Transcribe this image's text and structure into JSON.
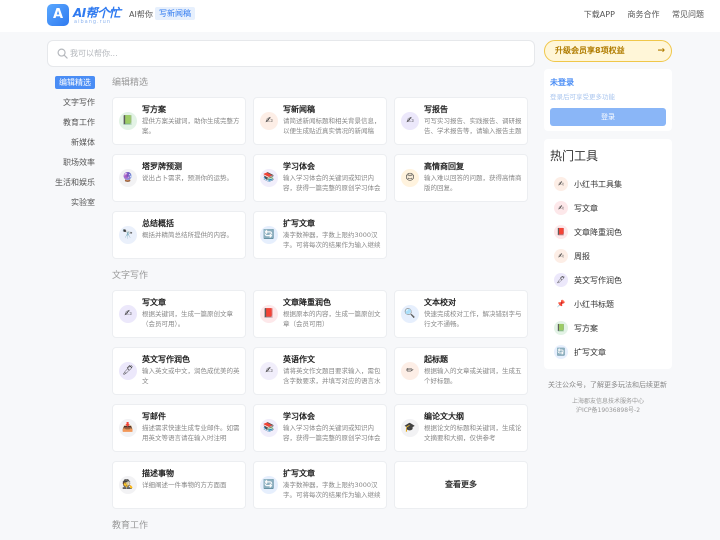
{
  "header": {
    "logo_letter": "A",
    "logo_name": "AI帮个忙",
    "logo_sub": "aibang.run",
    "tagline": "AI帮你",
    "tagline_badge": "写新闻稿",
    "nav": [
      "下载APP",
      "商务合作",
      "常见问题"
    ]
  },
  "search": {
    "placeholder": "我可以帮你..."
  },
  "menu": [
    "编辑精选",
    "文字写作",
    "教育工作",
    "新媒体",
    "职场效率",
    "生活和娱乐",
    "实验室"
  ],
  "sections": [
    {
      "title": "编辑精选",
      "cards": [
        {
          "title": "写方案",
          "desc": "提供方案关键词，助你生成完整方案。",
          "icon": "📗"
        },
        {
          "title": "写新闻稿",
          "desc": "请简述新闻标题和相关背景信息，以便生成贴近真实情况的新闻稿",
          "icon": "✍"
        },
        {
          "title": "写报告",
          "desc": "可写实习报告、实践报告、调研报告、学术报告等，请输入报告主题",
          "icon": "✍"
        },
        {
          "title": "塔罗牌预测",
          "desc": "说出占卜需求，预测你的运势。",
          "icon": "🔮"
        },
        {
          "title": "学习体会",
          "desc": "输入学习体会的关键词或知识内容，获得一篇完整的原创学习体会",
          "icon": "📚"
        },
        {
          "title": "高情商回复",
          "desc": "输入难以回答的问题，获得高情商版的回复。",
          "icon": "😊"
        },
        {
          "title": "总结概括",
          "desc": "概括并精简总结所提供的内容。",
          "icon": "🔭"
        },
        {
          "title": "扩写文章",
          "desc": "凑字数神器，字数上限约3000汉字。可将每次的结果作为输入继续扩写",
          "icon": "🔄"
        }
      ]
    },
    {
      "title": "文字写作",
      "cards": [
        {
          "title": "写文章",
          "desc": "根据关键词，生成一篇原创文章（会员可用）。",
          "icon": "✍"
        },
        {
          "title": "文章降重润色",
          "desc": "根据原本的内容，生成一篇原创文章（会员可用）",
          "icon": "📕"
        },
        {
          "title": "文本校对",
          "desc": "快速完成校对工作，解决错别字与行文不通畅。",
          "icon": "🔍"
        },
        {
          "title": "英文写作润色",
          "desc": "输入英文或中文，润色成优美的英文",
          "icon": "🖊"
        },
        {
          "title": "英语作文",
          "desc": "请将英文作文题目要求输入，需包含字数要求，并填写对应的语言水平",
          "icon": "✍"
        },
        {
          "title": "起标题",
          "desc": "根据输入的文章或关键词，生成五个好标题。",
          "icon": "✏"
        },
        {
          "title": "写邮件",
          "desc": "描述需求快速生成专业邮件。如需用英文等语言请在输入时注明",
          "icon": "📥"
        },
        {
          "title": "学习体会",
          "desc": "输入学习体会的关键词或知识内容，获得一篇完整的原创学习体会",
          "icon": "📚"
        },
        {
          "title": "编论文大纲",
          "desc": "根据论文的标题和关键词，生成论文摘要和大纲，仅供参考",
          "icon": "🎓"
        },
        {
          "title": "描述事物",
          "desc": "详细阐述一件事物的方方面面",
          "icon": "🕵"
        },
        {
          "title": "扩写文章",
          "desc": "凑字数神器，字数上限约3000汉字。可将每次的结果作为输入继续扩写",
          "icon": "🔄"
        }
      ],
      "more": "查看更多"
    },
    {
      "title": "教育工作"
    }
  ],
  "sidebar": {
    "upgrade": "升级会员享8项权益",
    "upgrade_arrow": "→",
    "login_status": "未登录",
    "login_tip": "登录后可享受更多功能",
    "login_button": "登录",
    "tools_title": "热门工具",
    "tools": [
      {
        "label": "小红书工具集",
        "icon": "✍"
      },
      {
        "label": "写文章",
        "icon": "✍"
      },
      {
        "label": "文章降重润色",
        "icon": "📕"
      },
      {
        "label": "周报",
        "icon": "✍"
      },
      {
        "label": "英文写作润色",
        "icon": "🖊"
      },
      {
        "label": "小红书标题",
        "icon": "📌"
      },
      {
        "label": "写方案",
        "icon": "📗"
      },
      {
        "label": "扩写文章",
        "icon": "🔄"
      }
    ],
    "follow": "关注公众号，了解更多玩法和后续更新",
    "footer_company": "上海郡友信息技术服务中心",
    "footer_icp": "沪ICP备19036898号-2"
  }
}
